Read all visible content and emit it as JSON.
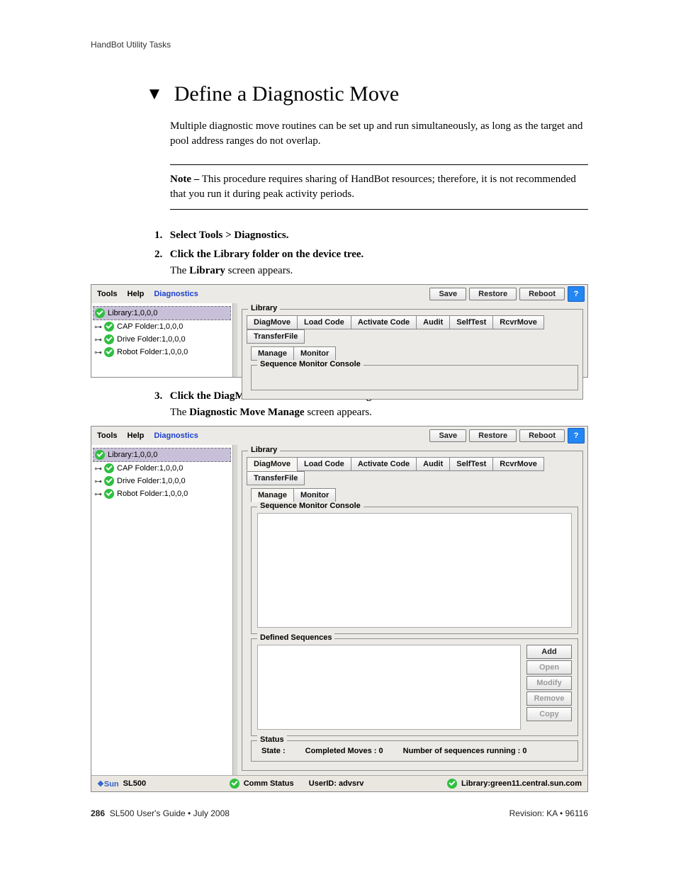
{
  "running_head": "HandBot Utility Tasks",
  "section_title": "Define a Diagnostic Move",
  "intro": "Multiple diagnostic move routines can be set up and run simultaneously, as long as the target and pool address ranges do not overlap.",
  "note_label": "Note –",
  "note_body": " This procedure requires sharing of HandBot resources; therefore, it is not recommended that you run it during peak activity periods.",
  "steps": {
    "s1": {
      "num": "1.",
      "text": "Select Tools > Diagnostics."
    },
    "s2": {
      "num": "2.",
      "text": "Click the Library folder on the device tree.",
      "sub_pre": "The ",
      "sub_bold": "Library",
      "sub_post": " screen appears."
    },
    "s3": {
      "num": "3.",
      "text": "Click the DiagMove tab and then the Manage tab.",
      "sub_pre": "The ",
      "sub_bold": "Diagnostic Move Manage",
      "sub_post": " screen appears."
    }
  },
  "ui": {
    "menu": {
      "tools": "Tools",
      "help": "Help",
      "diagnostics": "Diagnostics"
    },
    "toolbar": {
      "save": "Save",
      "restore": "Restore",
      "reboot": "Reboot",
      "help": "?"
    },
    "tree": {
      "root": "Library:1,0,0,0",
      "cap": "CAP Folder:1,0,0,0",
      "drive": "Drive Folder:1,0,0,0",
      "robot": "Robot Folder:1,0,0,0"
    },
    "fieldset_label": "Library",
    "tabs": {
      "diag": "DiagMove",
      "load": "Load Code",
      "activate": "Activate Code",
      "audit": "Audit",
      "selftest": "SelfTest",
      "rcvr": "RcvrMove",
      "transfer": "TransferFile"
    },
    "subtabs": {
      "manage": "Manage",
      "monitor": "Monitor"
    },
    "console_label": "Sequence Monitor Console",
    "defseq_label": "Defined Sequences",
    "defseq_btns": {
      "add": "Add",
      "open": "Open",
      "modify": "Modify",
      "remove": "Remove",
      "copy": "Copy"
    },
    "status_label": "Status",
    "status": {
      "state": "State :",
      "completed": "Completed Moves : 0",
      "running": "Number of sequences running : 0"
    },
    "statusbar": {
      "sun": "Sun",
      "product": "SL500",
      "comm": "Comm Status",
      "userid": "UserID: advsrv",
      "library": "Library:green11.central.sun.com"
    }
  },
  "footer": {
    "page": "286",
    "book": "SL500 User's Guide • July 2008",
    "rev": "Revision: KA • 96116"
  }
}
